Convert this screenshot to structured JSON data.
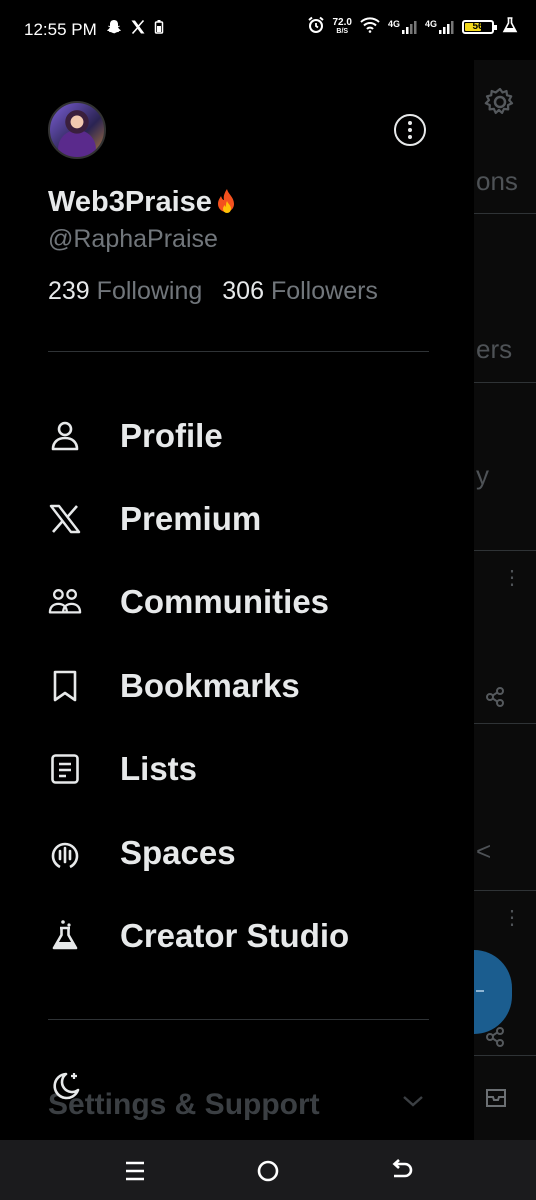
{
  "status_bar": {
    "time": "12:55 PM",
    "net_speed_value": "72.0",
    "net_speed_unit": "B/S",
    "sim1_label": "4G",
    "sim2_label": "4G",
    "battery_level": "56",
    "icons": [
      "snapchat-icon",
      "x-logo-icon",
      "battery-saver-icon",
      "alarm-icon",
      "wifi-icon",
      "signal-icon",
      "flask-icon"
    ]
  },
  "backdrop": {
    "peek_texts": [
      "ons",
      "ers",
      "y",
      "<"
    ]
  },
  "profile": {
    "display_name": "Web3Praise",
    "name_emoji": "fire",
    "handle": "@RaphaPraise",
    "following_count": "239",
    "following_label": "Following",
    "followers_count": "306",
    "followers_label": "Followers"
  },
  "menu": {
    "items": [
      {
        "label": "Profile",
        "icon": "person-icon"
      },
      {
        "label": "Premium",
        "icon": "x-logo-icon"
      },
      {
        "label": "Communities",
        "icon": "communities-icon"
      },
      {
        "label": "Bookmarks",
        "icon": "bookmark-icon"
      },
      {
        "label": "Lists",
        "icon": "list-icon"
      },
      {
        "label": "Spaces",
        "icon": "spaces-icon"
      },
      {
        "label": "Creator Studio",
        "icon": "flask-icon"
      }
    ]
  },
  "settings": {
    "label": "Settings & Support"
  },
  "colors": {
    "background": "#000000",
    "text_primary": "#e7e9ea",
    "text_secondary": "#71767b",
    "divider": "#2f3336",
    "fab": "#1b5d8f"
  }
}
